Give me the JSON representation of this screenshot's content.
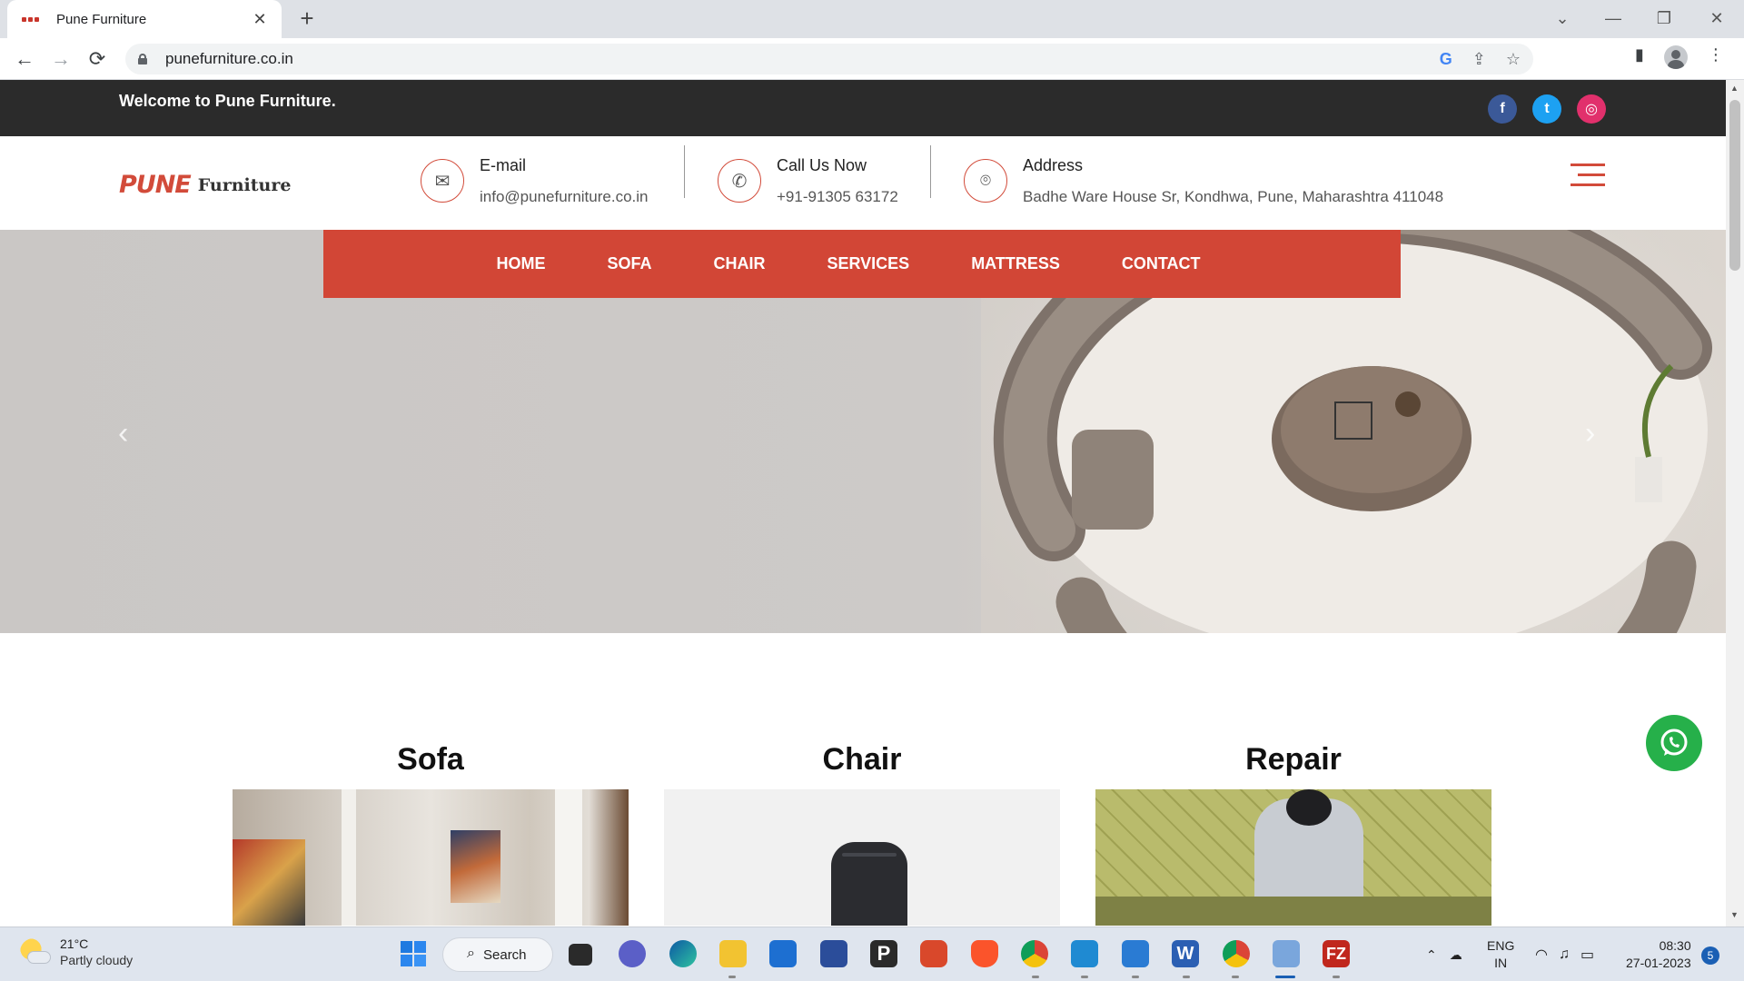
{
  "browser": {
    "tab_title": "Pune Furniture",
    "tab_close": "✕",
    "new_tab": "+",
    "url": "punefurniture.co.in",
    "back": "←",
    "forward": "→",
    "reload": "⟳"
  },
  "site": {
    "welcome": "Welcome to Pune Furniture.",
    "social": [
      {
        "name": "facebook",
        "glyph": "f",
        "color": "#3b5998"
      },
      {
        "name": "twitter",
        "glyph": "t",
        "color": "#1da1f2"
      },
      {
        "name": "instagram",
        "glyph": "◎",
        "color": "#e1306c"
      }
    ],
    "logo": {
      "mark": "PUNE",
      "text": "Furniture"
    },
    "contacts": [
      {
        "title": "E-mail",
        "value": "info@punefurniture.co.in",
        "icon": "envelope-icon"
      },
      {
        "title": "Call Us Now",
        "value": "+91-91305 63172",
        "icon": "phone-icon"
      },
      {
        "title": "Address",
        "value": "Badhe Ware House Sr, Kondhwa, Pune, Maharashtra 411048",
        "icon": "location-icon"
      }
    ],
    "nav": [
      "HOME",
      "SOFA",
      "CHAIR",
      "SERVICES",
      "MATTRESS",
      "CONTACT"
    ],
    "categories": [
      "Sofa",
      "Chair",
      "Repair"
    ],
    "accent": "#d24636"
  },
  "taskbar": {
    "temp": "21°C",
    "weather": "Partly cloudy",
    "search": "Search",
    "lang1": "ENG",
    "lang2": "IN",
    "time": "08:30",
    "date": "27-01-2023",
    "notifications": "5"
  }
}
